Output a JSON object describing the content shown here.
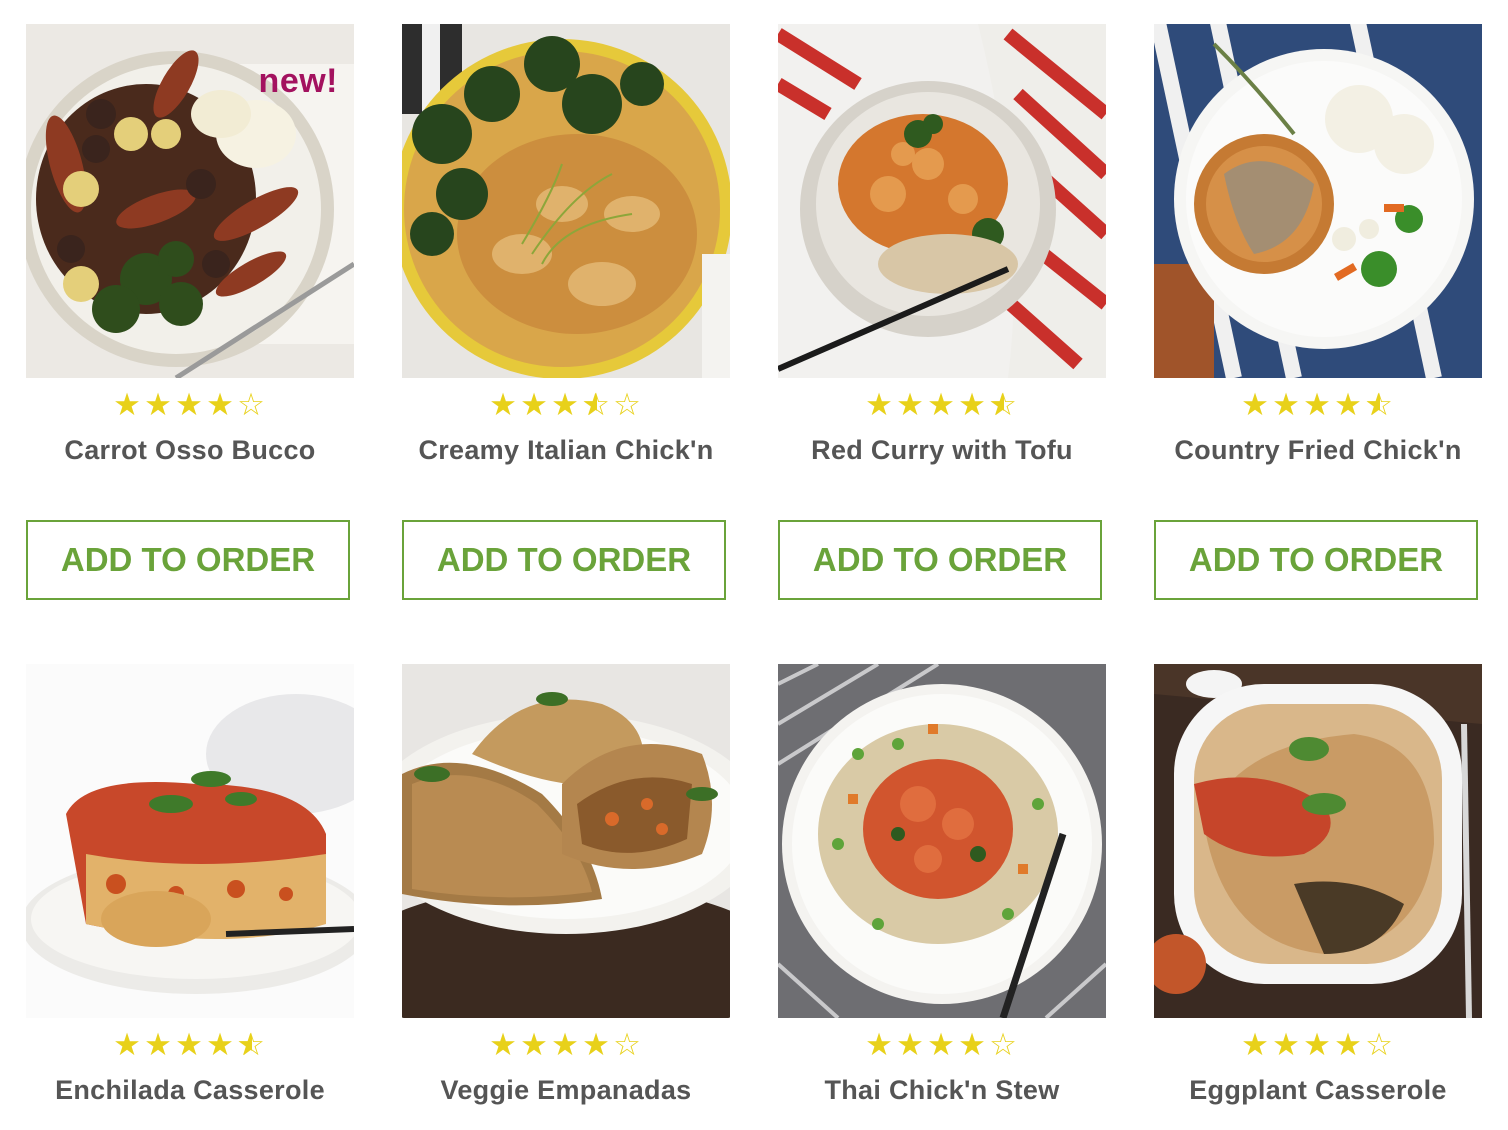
{
  "colors": {
    "accent": "#6aa33a",
    "star": "#e8d11a",
    "badge": "#a3125f",
    "title": "#555555"
  },
  "products": [
    {
      "name": "Carrot Osso Bucco",
      "rating": 4,
      "badge": "new!",
      "button": "ADD TO ORDER",
      "image": "carrot-osso-bucco-plate"
    },
    {
      "name": "Creamy Italian Chick'n",
      "rating": 3.5,
      "button": "ADD TO ORDER",
      "image": "creamy-italian-bowl"
    },
    {
      "name": "Red Curry with Tofu",
      "rating": 4.5,
      "button": "ADD TO ORDER",
      "image": "red-curry-bowl"
    },
    {
      "name": "Country Fried Chick'n",
      "rating": 4.5,
      "button": "ADD TO ORDER",
      "image": "country-fried-plate"
    },
    {
      "name": "Enchilada Casserole",
      "rating": 4.5,
      "image": "enchilada-casserole-slice"
    },
    {
      "name": "Veggie Empanadas",
      "rating": 4,
      "image": "empanadas-plate"
    },
    {
      "name": "Thai Chick'n Stew",
      "rating": 4,
      "image": "thai-stew-plate"
    },
    {
      "name": "Eggplant Casserole",
      "rating": 4,
      "image": "eggplant-casserole-dish"
    }
  ]
}
